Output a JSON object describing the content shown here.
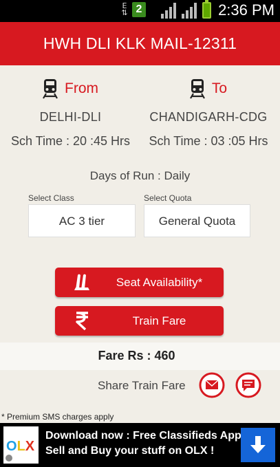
{
  "status_bar": {
    "e_indicator": "E",
    "badge": "2",
    "time": "2:36 PM"
  },
  "header": {
    "title": "HWH DLI KLK MAIL-12311"
  },
  "journey": {
    "from": {
      "label": "From",
      "station": "DELHI-DLI",
      "sch_time": "Sch Time : 20 :45 Hrs",
      "icon": "train-icon"
    },
    "to": {
      "label": "To",
      "station": "CHANDIGARH-CDG",
      "sch_time": "Sch Time : 03 :05 Hrs",
      "icon": "train-icon"
    },
    "days_of_run": "Days of Run : Daily"
  },
  "selectors": {
    "class_label": "Select Class",
    "class_value": "AC 3 tier",
    "quota_label": "Select Quota",
    "quota_value": "General Quota"
  },
  "actions": {
    "seat_availability": "Seat Availability*",
    "train_fare": "Train Fare"
  },
  "fare": {
    "text": "Fare Rs : 460"
  },
  "share": {
    "label": "Share Train Fare",
    "email_icon": "email-icon",
    "sms_icon": "sms-icon"
  },
  "footnote": "* Premium SMS charges apply",
  "ad": {
    "line1": "Download now : Free Classifieds App",
    "line2": "Sell and Buy your stuff on OLX !",
    "logo": "OLX",
    "icon": "download-icon"
  },
  "colors": {
    "accent": "#d71920",
    "background": "#f1eee7",
    "ad_button": "#1565d8"
  }
}
